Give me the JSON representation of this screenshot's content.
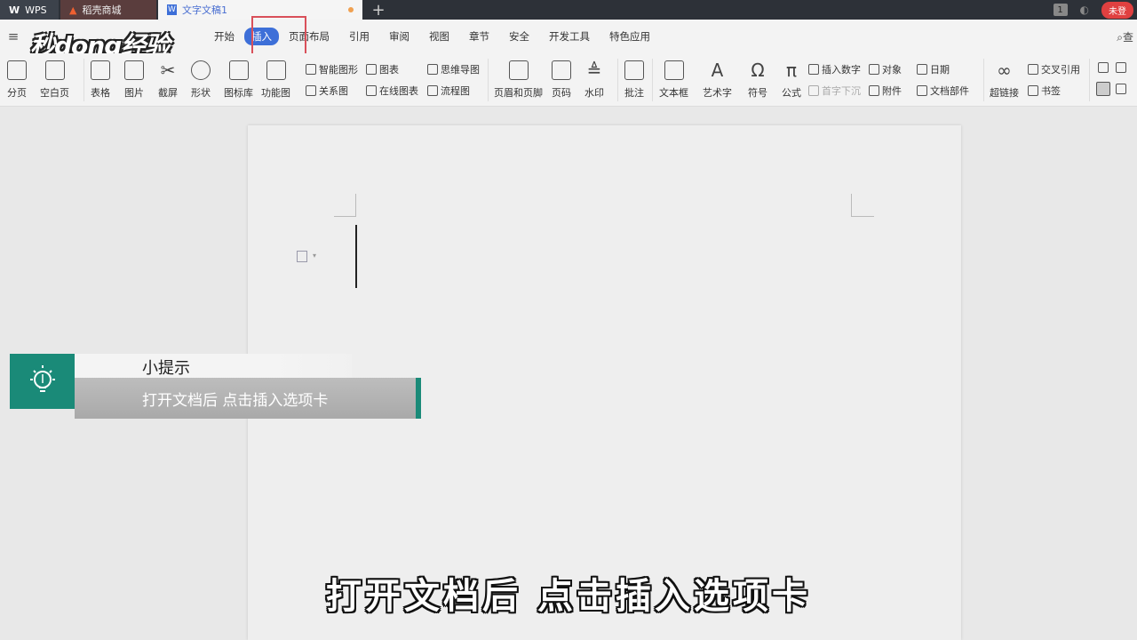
{
  "titlebar": {
    "tabs": [
      {
        "label": "WPS"
      },
      {
        "label": "稻壳商城"
      },
      {
        "label": "文字文稿1"
      }
    ],
    "add_label": "+",
    "badge": "1",
    "login_label": "未登"
  },
  "menubar": {
    "items": [
      "开始",
      "插入",
      "页面布局",
      "引用",
      "审阅",
      "视图",
      "章节",
      "安全",
      "开发工具",
      "特色应用"
    ],
    "search_label": "查"
  },
  "logo": "秒dong经验",
  "toolbar": {
    "big": {
      "page_break": "分页",
      "blank_page": "空白页",
      "table": "表格",
      "picture": "图片",
      "screenshot": "截屏",
      "shape": "形状",
      "icon_lib": "图标库",
      "func_chart": "功能图",
      "header_footer": "页眉和页脚",
      "page_num": "页码",
      "watermark": "水印",
      "comment": "批注",
      "textbox": "文本框",
      "wordart": "艺术字",
      "symbol": "符号",
      "formula": "公式",
      "hyperlink": "超链接"
    },
    "small": {
      "smart_shape": "智能图形",
      "chart": "图表",
      "mindmap": "思维导图",
      "relation": "关系图",
      "online_chart": "在线图表",
      "flowchart": "流程图",
      "insert_number": "插入数字",
      "object": "对象",
      "date": "日期",
      "drop_cap": "首字下沉",
      "attachment": "附件",
      "doc_parts": "文档部件",
      "cross_ref": "交叉引用",
      "bookmark": "书签"
    }
  },
  "tip": {
    "title": "小提示",
    "body": "打开文档后 点击插入选项卡"
  },
  "subtitle": "打开文档后  点击插入选项卡"
}
